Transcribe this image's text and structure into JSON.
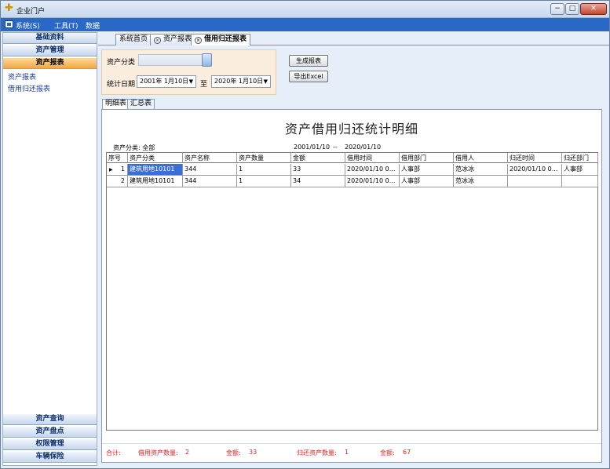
{
  "window": {
    "title": "企业门户",
    "min": "−",
    "max": "□",
    "close": "✕"
  },
  "menu": {
    "items": [
      "系统(S)",
      "工具(T)",
      "数据"
    ]
  },
  "sidebar": {
    "top_headers": [
      "基础资料",
      "资产管理",
      "资产报表"
    ],
    "links": [
      "资产报表",
      "借用归还报表"
    ],
    "bottom_headers": [
      "资产查询",
      "资产盘点",
      "权限管理",
      "车辆保险"
    ]
  },
  "tabs": {
    "home": "系统首页",
    "asset_report": "资产报表",
    "borrow_report": "借用归还报表",
    "close_glyph": "×"
  },
  "filter": {
    "category_label": "资产分类",
    "date_label": "统计日期",
    "start_date": "2001年 1月10日",
    "to_label": "至",
    "end_date": "2020年 1月10日",
    "dropdown_glyph": "▼"
  },
  "actions": {
    "generate": "生成报表",
    "export": "导出Excel"
  },
  "subtabs": [
    "明细表",
    "汇总表"
  ],
  "report": {
    "title": "资产借用归还统计明细",
    "category_info": "资产分类:  全部",
    "period_start": "2001/01/10",
    "period_sep": "--",
    "period_end": "2020/01/10"
  },
  "grid": {
    "columns": [
      "序号",
      "资产分类",
      "资产名称",
      "资产数量",
      "金额",
      "借用时间",
      "借用部门",
      "借用人",
      "归还时间",
      "归还部门"
    ],
    "current_row_marker": "▶",
    "rows": [
      [
        "1",
        "建筑用地10101",
        "344",
        "1",
        "33",
        "2020/01/10 0...",
        "人事部",
        "范冰冰",
        "2020/01/10 0...",
        "人事部"
      ],
      [
        "2",
        "建筑用地10101",
        "344",
        "1",
        "34",
        "2020/01/10 0...",
        "人事部",
        "范冰冰",
        "",
        ""
      ]
    ]
  },
  "summary": {
    "total_label": "合计:",
    "borrow_qty_label": "借用资产数量:",
    "borrow_qty": "2",
    "borrow_amount_label": "金额:",
    "borrow_amount": "33",
    "return_qty_label": "归还资产数量:",
    "return_qty": "1",
    "return_amount_label": "金额:",
    "return_amount": "67"
  }
}
